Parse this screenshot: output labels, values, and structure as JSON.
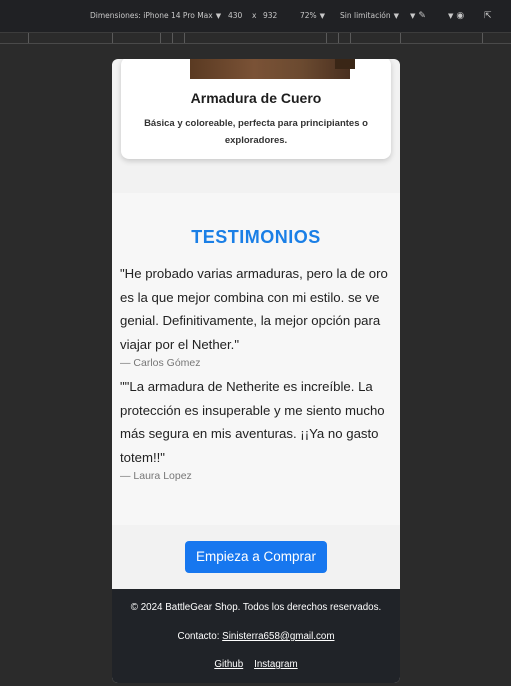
{
  "devtools": {
    "device": "Dimensiones: iPhone 14 Pro Max",
    "width": "430",
    "times": "x",
    "height": "932",
    "zoom": "72%",
    "throttle": "Sin limitación"
  },
  "product": {
    "title": "Armadura de Cuero",
    "description": "Básica y coloreable, perfecta para principiantes o exploradores."
  },
  "testimonials": {
    "heading": "TESTIMONIOS",
    "items": [
      {
        "quote": "\"He probado varias armaduras, pero la de oro es la que mejor combina con mi estilo. se ve genial. Definitivamente, la mejor opción para viajar por el Nether.\"",
        "author": "— Carlos Gómez"
      },
      {
        "quote": "\"\"La armadura de Netherite es increíble. La protección es insuperable y me siento mucho más segura en mis aventuras. ¡¡Ya no gasto totem!!\"",
        "author": "— Laura Lopez"
      }
    ]
  },
  "cta": {
    "label": "Empieza a Comprar"
  },
  "footer": {
    "copyright": "© 2024 BattleGear Shop. Todos los derechos reservados.",
    "contact_label": "Contacto: ",
    "contact_email": "Sinisterra658@gmail.com",
    "github": "Github",
    "instagram": "Instagram"
  }
}
